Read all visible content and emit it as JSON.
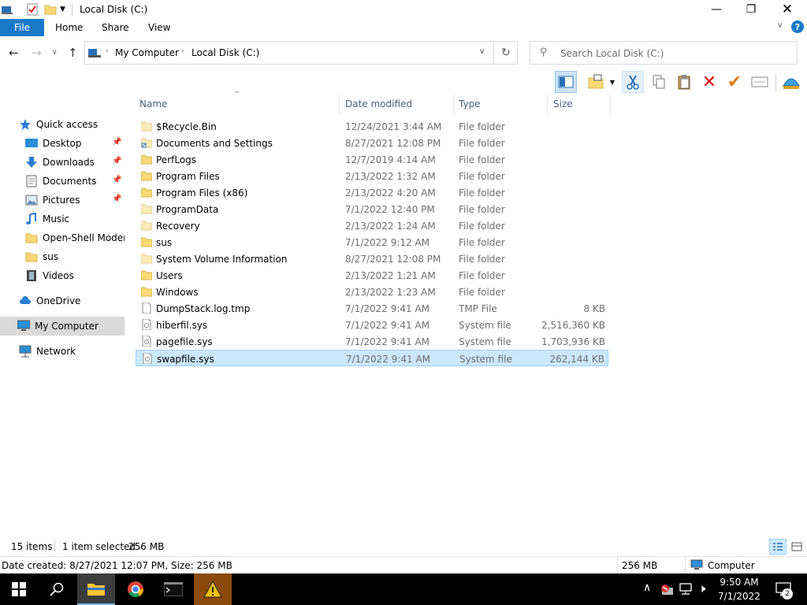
{
  "window": {
    "title": "Local Disk (C:)"
  },
  "ribbon": {
    "tabs": [
      "File",
      "Home",
      "Share",
      "View"
    ]
  },
  "address": {
    "crumbs": [
      "My Computer",
      "Local Disk (C:)"
    ],
    "search_placeholder": "Search Local Disk (C:)"
  },
  "sidebar": {
    "items": [
      {
        "label": "Quick access",
        "icon": "star-icon"
      },
      {
        "label": "Desktop",
        "icon": "desktop-icon",
        "pinned": true
      },
      {
        "label": "Downloads",
        "icon": "download-icon",
        "pinned": true
      },
      {
        "label": "Documents",
        "icon": "documents-icon",
        "pinned": true
      },
      {
        "label": "Pictures",
        "icon": "pictures-icon",
        "pinned": true
      },
      {
        "label": "Music",
        "icon": "music-icon"
      },
      {
        "label": "Open-Shell Modern",
        "icon": "folder-icon"
      },
      {
        "label": "sus",
        "icon": "folder-icon"
      },
      {
        "label": "Videos",
        "icon": "videos-icon"
      },
      {
        "label": "OneDrive",
        "icon": "cloud-icon"
      },
      {
        "label": "My Computer",
        "icon": "computer-icon",
        "selected": true
      },
      {
        "label": "Network",
        "icon": "network-icon"
      }
    ]
  },
  "columns": [
    "Name",
    "Date modified",
    "Type",
    "Size"
  ],
  "files": [
    {
      "name": "$Recycle.Bin",
      "date": "12/24/2021 3:44 AM",
      "type": "File folder",
      "size": "",
      "icon": "folder-pale"
    },
    {
      "name": "Documents and Settings",
      "date": "8/27/2021 12:08 PM",
      "type": "File folder",
      "size": "",
      "icon": "folder-link"
    },
    {
      "name": "PerfLogs",
      "date": "12/7/2019 4:14 AM",
      "type": "File folder",
      "size": "",
      "icon": "folder"
    },
    {
      "name": "Program Files",
      "date": "2/13/2022 1:32 AM",
      "type": "File folder",
      "size": "",
      "icon": "folder"
    },
    {
      "name": "Program Files (x86)",
      "date": "2/13/2022 4:20 AM",
      "type": "File folder",
      "size": "",
      "icon": "folder"
    },
    {
      "name": "ProgramData",
      "date": "7/1/2022 12:40 PM",
      "type": "File folder",
      "size": "",
      "icon": "folder-pale"
    },
    {
      "name": "Recovery",
      "date": "2/13/2022 1:24 AM",
      "type": "File folder",
      "size": "",
      "icon": "folder-pale"
    },
    {
      "name": "sus",
      "date": "7/1/2022 9:12 AM",
      "type": "File folder",
      "size": "",
      "icon": "folder"
    },
    {
      "name": "System Volume Information",
      "date": "8/27/2021 12:08 PM",
      "type": "File folder",
      "size": "",
      "icon": "folder-pale"
    },
    {
      "name": "Users",
      "date": "2/13/2022 1:21 AM",
      "type": "File folder",
      "size": "",
      "icon": "folder"
    },
    {
      "name": "Windows",
      "date": "2/13/2022 1:23 AM",
      "type": "File folder",
      "size": "",
      "icon": "folder"
    },
    {
      "name": "DumpStack.log.tmp",
      "date": "7/1/2022 9:41 AM",
      "type": "TMP File",
      "size": "8 KB",
      "icon": "file"
    },
    {
      "name": "hiberfil.sys",
      "date": "7/1/2022 9:41 AM",
      "type": "System file",
      "size": "2,516,360 KB",
      "icon": "sysfile"
    },
    {
      "name": "pagefile.sys",
      "date": "7/1/2022 9:41 AM",
      "type": "System file",
      "size": "1,703,936 KB",
      "icon": "sysfile"
    },
    {
      "name": "swapfile.sys",
      "date": "7/1/2022 9:41 AM",
      "type": "System file",
      "size": "262,144 KB",
      "icon": "sysfile",
      "selected": true
    }
  ],
  "status": {
    "count": "15 items",
    "selection": "1 item selected",
    "selection_size": "256 MB"
  },
  "info": {
    "details": "Date created: 8/27/2021 12:07 PM, Size: 256 MB",
    "size": "256 MB",
    "location": "Computer"
  },
  "taskbar": {
    "time": "9:50 AM",
    "date": "7/1/2022",
    "notifications": "2"
  },
  "colors": {
    "accent": "#1979ca",
    "selection": "#cce8ff",
    "folder": "#f8d775"
  }
}
